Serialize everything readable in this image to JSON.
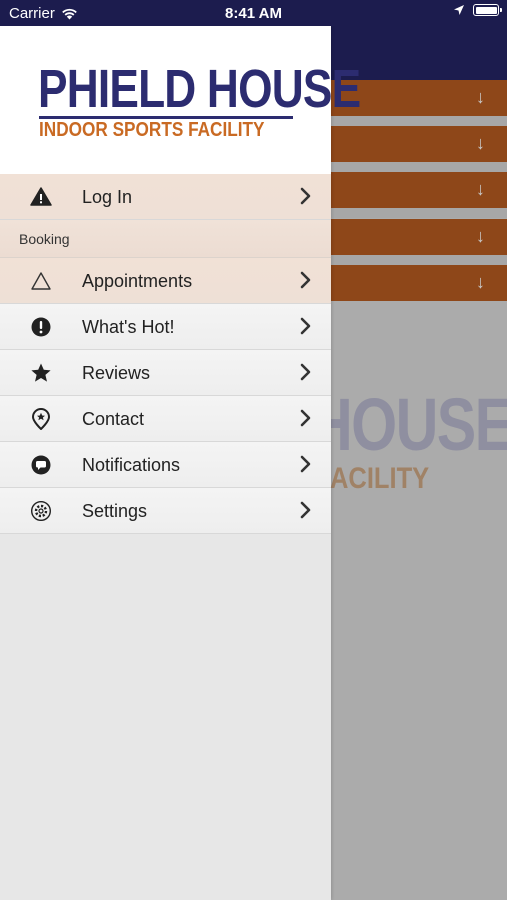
{
  "status_bar": {
    "carrier": "Carrier",
    "time": "8:41 AM"
  },
  "background": {
    "logo_partial_main": "HOUSE",
    "logo_partial_sub": "ACILITY",
    "row_count": 5
  },
  "drawer": {
    "logo": {
      "main": "PHIELD HOUSE",
      "sub": "INDOOR SPORTS FACILITY"
    },
    "login": {
      "label": "Log In",
      "icon": "warning-icon"
    },
    "section": {
      "label": "Booking"
    },
    "items": [
      {
        "label": "Appointments",
        "icon": "triangle-outline-icon",
        "highlight": true
      },
      {
        "label": "What's Hot!",
        "icon": "exclamation-circle-icon"
      },
      {
        "label": "Reviews",
        "icon": "star-icon"
      },
      {
        "label": "Contact",
        "icon": "map-pin-icon"
      },
      {
        "label": "Notifications",
        "icon": "chat-bubble-icon"
      },
      {
        "label": "Settings",
        "icon": "gear-icon"
      }
    ]
  },
  "colors": {
    "navy": "#1c1c4e",
    "logo_navy": "#2c2c70",
    "logo_orange": "#c96a23",
    "row_brown": "#8e4719",
    "highlight": "#f1e1d6"
  }
}
